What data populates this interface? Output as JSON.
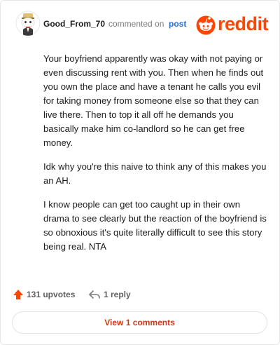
{
  "header": {
    "username": "Good_From_70",
    "action_text": "commented on",
    "post_link": "post",
    "logo_text": "reddit",
    "brand_color": "#ff4500"
  },
  "comment": {
    "paragraphs": [
      "Your boyfriend apparently was okay with not paying or even discussing rent with you. Then when he finds out you own the place and have a tenant he calls you evil for taking money from someone else so that they can live there. Then to top it all off he demands you basically make him co-landlord so he can get free money.",
      "Idk why you're this naive to think any of this makes you an AH.",
      "I know people can get too caught up in their own drama to see clearly but the reaction of the boyfriend is so obnoxious it's quite literally difficult to see this story being real. NTA"
    ]
  },
  "footer": {
    "upvotes": "131 upvotes",
    "replies": "1 reply",
    "upvote_icon": "upvote-arrow-icon",
    "reply_icon": "reply-arrow-icon"
  },
  "view_comments": {
    "label": "View 1 comments",
    "color": "#c93a14"
  }
}
